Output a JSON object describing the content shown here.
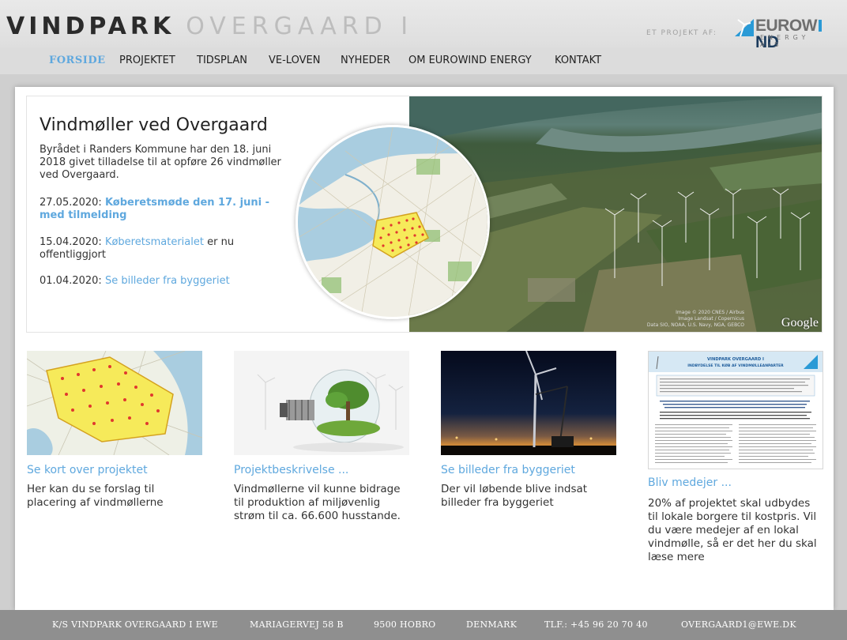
{
  "header": {
    "logo_main": "VINDPARK",
    "logo_sub": "OVERGAARD I",
    "tagline": "ET PROJEKT AF:",
    "brand_name_a": "EUROW",
    "brand_name_b": "ND",
    "brand_sub": "ENERGY A/S",
    "brand_icon": "wind-turbine-logo-icon"
  },
  "nav": {
    "items": [
      {
        "label": "FORSIDE",
        "active": true
      },
      {
        "label": "PROJEKTET"
      },
      {
        "label": "TIDSPLAN"
      },
      {
        "label": "VE-LOVEN"
      },
      {
        "label": "NYHEDER"
      },
      {
        "label": "OM EUROWIND ENERGY"
      },
      {
        "label": "KONTAKT"
      }
    ]
  },
  "hero": {
    "title": "Vindmøller ved Overgaard",
    "text": "Byrådet i Randers Kommune har den 18. juni 2018 givet tilladelse til at opføre 26 vindmøller ved Overgaard.",
    "news": [
      {
        "date": "27.05.2020: ",
        "link": "Køberetsmøde den 17. juni - med tilmelding",
        "rest": ""
      },
      {
        "date": "15.04.2020: ",
        "link": "Køberetsmaterialet",
        "rest": " er nu offentliggjort"
      },
      {
        "date": "01.04.2020: ",
        "link": "Se billeder fra byggeriet",
        "rest": ""
      }
    ],
    "credit_line1": "Image © 2020 CNES / Airbus",
    "credit_line2": "Image Landsat / Copernicus",
    "credit_line3": "Data SIO, NOAA, U.S. Navy, NGA, GEBCO",
    "google": "Google"
  },
  "tiles": [
    {
      "title": "Se kort over projektet",
      "text": "Her kan du se forslag til placering af vindmøllerne"
    },
    {
      "title": "Projektbeskrivelse ...",
      "text": "Vindmøllerne vil kunne bidrage til produktion af miljøvenlig strøm til ca. 66.600 husstande."
    },
    {
      "title": "Se billeder fra byggeriet",
      "text": "Der vil løbende blive indsat billeder fra byggeriet"
    },
    {
      "title": "Bliv medejer ...",
      "text": "20% af projektet skal udbydes til lokale borgere til kostpris. Vil du være medejer af en lokal vindmølle, så er det her du skal læse mere"
    }
  ],
  "doc_thumb": {
    "title1": "VINDPARK OVERGAARD I",
    "title2": "INDBYDELSE TIL KØB AF VINDMØLLEANPARTER"
  },
  "footer": {
    "company": "K/S VINDPARK OVERGAARD I EWE",
    "address": "MARIAGERVEJ 58 B",
    "city": "9500 HOBRO",
    "country": "DENMARK",
    "phone": "TLF.: +45 96 20 70 40",
    "email": "OVERGAARD1@EWE.DK"
  },
  "colors": {
    "accent": "#5fa8de",
    "footer_bg": "#8f8f8f",
    "header_bg": "#e3e3e3"
  }
}
